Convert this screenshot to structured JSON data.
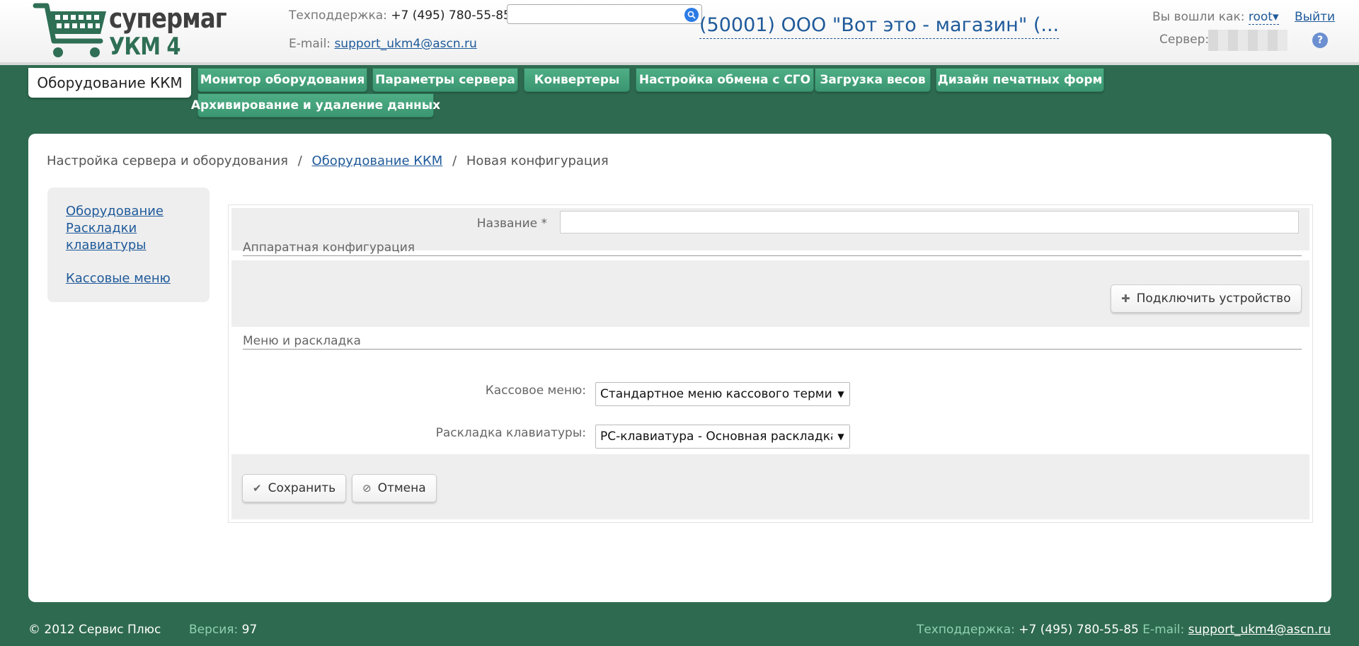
{
  "header": {
    "logo_line1": "супермаг",
    "logo_line2": "УКМ 4",
    "support_label": "Техподдержка:",
    "support_phone": "+7 (495) 780-55-85",
    "email_label": "E-mail:",
    "email": "support_ukm4@ascn.ru",
    "search_placeholder": "",
    "org_name": "(50001) ООО \"Вот это - магазин\" (...",
    "login_label": "Вы вошли как:",
    "login_user": "root",
    "logout": "Выйти",
    "server_label": "Сервер:",
    "help": "?"
  },
  "nav": {
    "active": "Оборудование ККМ",
    "tabs": [
      "Монитор оборудования",
      "Параметры сервера",
      "Конвертеры",
      "Настройка обмена с СГО",
      "Загрузка весов",
      "Дизайн печатных форм",
      "Архивирование и удаление данных"
    ]
  },
  "breadcrumb": {
    "root": "Настройка сервера и оборудования",
    "sep": "/",
    "link": "Оборудование ККМ",
    "current": "Новая конфигурация"
  },
  "sidemenu": {
    "items": [
      "Оборудование",
      "Раскладки клавиатуры",
      "Кассовые меню"
    ]
  },
  "form": {
    "name_label": "Название *",
    "name_value": "",
    "hw_section": "Аппаратная конфигурация",
    "connect_device": "Подключить устройство",
    "menu_section": "Меню и раскладка",
    "cash_menu_label": "Кассовое меню:",
    "cash_menu_value": "Стандартное меню кассового терминала",
    "keyboard_label": "Раскладка клавиатуры:",
    "keyboard_value": "PC-клавиатура - Основная раскладка (",
    "save": "Сохранить",
    "cancel": "Отмена"
  },
  "footer": {
    "copyright": "© 2012 Сервис Плюс",
    "version_label": "Версия:",
    "version": "97",
    "support_label": "Техподдержка:",
    "support_phone": "+7 (495) 780-55-85",
    "email_label": "E-mail:",
    "email": "support_ukm4@ascn.ru"
  },
  "colors": {
    "background": "#2e6a4f",
    "nav_button": "#3f9c75",
    "link": "#1f5a9a"
  }
}
